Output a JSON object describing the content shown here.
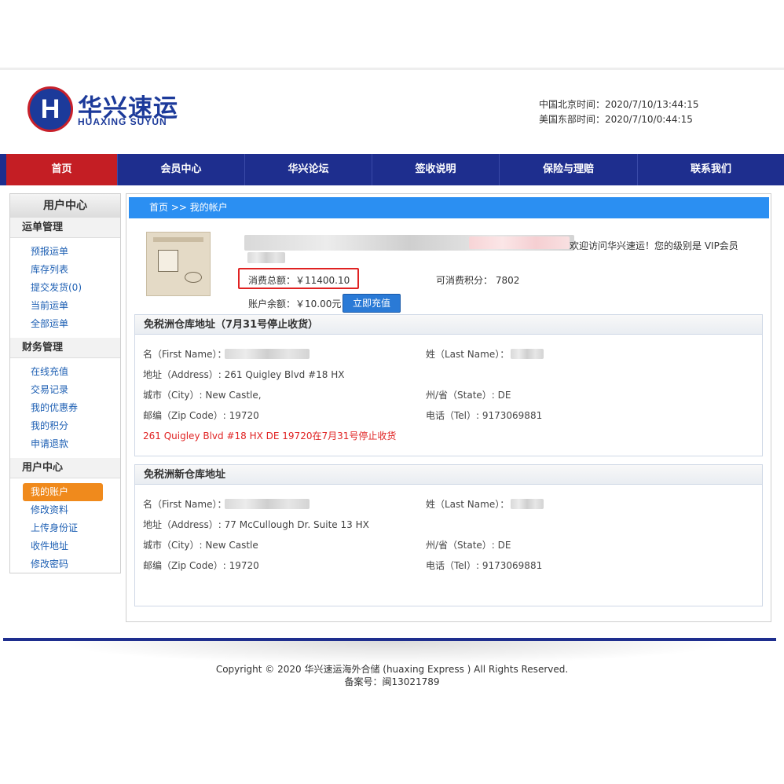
{
  "header": {
    "logo_mark": "H",
    "logo_cn": "华兴速运",
    "logo_en": "HUAXING SUYUN",
    "beijing_time": "中国北京时间：2020/7/10/13:44:15",
    "us_east_time": "美国东部时间：2020/7/10/0:44:15"
  },
  "nav": {
    "items": [
      "首页",
      "会员中心",
      "华兴论坛",
      "签收说明",
      "保险与理赔",
      "联系我们"
    ],
    "active_index": 0
  },
  "sidebar": {
    "title": "用户中心",
    "groups": [
      {
        "title": "运单管理",
        "links": [
          "预报运单",
          "库存列表",
          "提交发货(0)",
          "当前运单",
          "全部运单"
        ]
      },
      {
        "title": "财务管理",
        "links": [
          "在线充值",
          "交易记录",
          "我的优惠券",
          "我的积分",
          "申请退款"
        ]
      },
      {
        "title": "用户中心",
        "links": [
          "我的账户",
          "修改资料",
          "上传身份证",
          "收件地址",
          "修改密码"
        ]
      }
    ],
    "current_link": "我的账户"
  },
  "main": {
    "breadcrumb": "首页 >> 我的帐户",
    "welcome_text": "欢迎访问华兴速运！您的级别是 VIP会员",
    "total_spent": "消费总额：￥11400.10",
    "points": "可消费积分： 7802",
    "balance": "账户余额：￥10.00元",
    "recharge_button": "立即充值"
  },
  "warehouse_old": {
    "title": "免税洲仓库地址（7月31号停止收货）",
    "first_name_label": "名（First Name）：",
    "last_name_label": "姓（Last Name）：",
    "address": "地址（Address）: 261 Quigley Blvd #18 HX",
    "city": "城市（City）: New Castle,",
    "state": "州/省（State）: DE",
    "zip": "邮编（Zip Code）: 19720",
    "tel": "电话（Tel）: 9173069881",
    "notice": "261 Quigley Blvd #18 HX DE 19720在7月31号停止收货"
  },
  "warehouse_new": {
    "title": "免税洲新仓库地址",
    "first_name_label": "名（First Name）：",
    "last_name_label": "姓（Last Name）：",
    "address": "地址（Address）: 77 McCullough Dr. Suite 13 HX",
    "city": "城市（City）: New Castle",
    "state": "州/省（State）: DE",
    "zip": "邮编（Zip Code）: 19720",
    "tel": "电话（Tel）: 9173069881"
  },
  "footer": {
    "copyright": "Copyright © 2020 华兴速运海外合储 (huaxing Express ) All Rights Reserved.",
    "icp": "备案号：闽13021789"
  },
  "colors": {
    "nav_bg": "#1e2e8e",
    "nav_active": "#c41e24",
    "breadcrumb_bg": "#2b8ff2",
    "sidebar_current": "#f08a1c",
    "highlight_red": "#e02222"
  }
}
